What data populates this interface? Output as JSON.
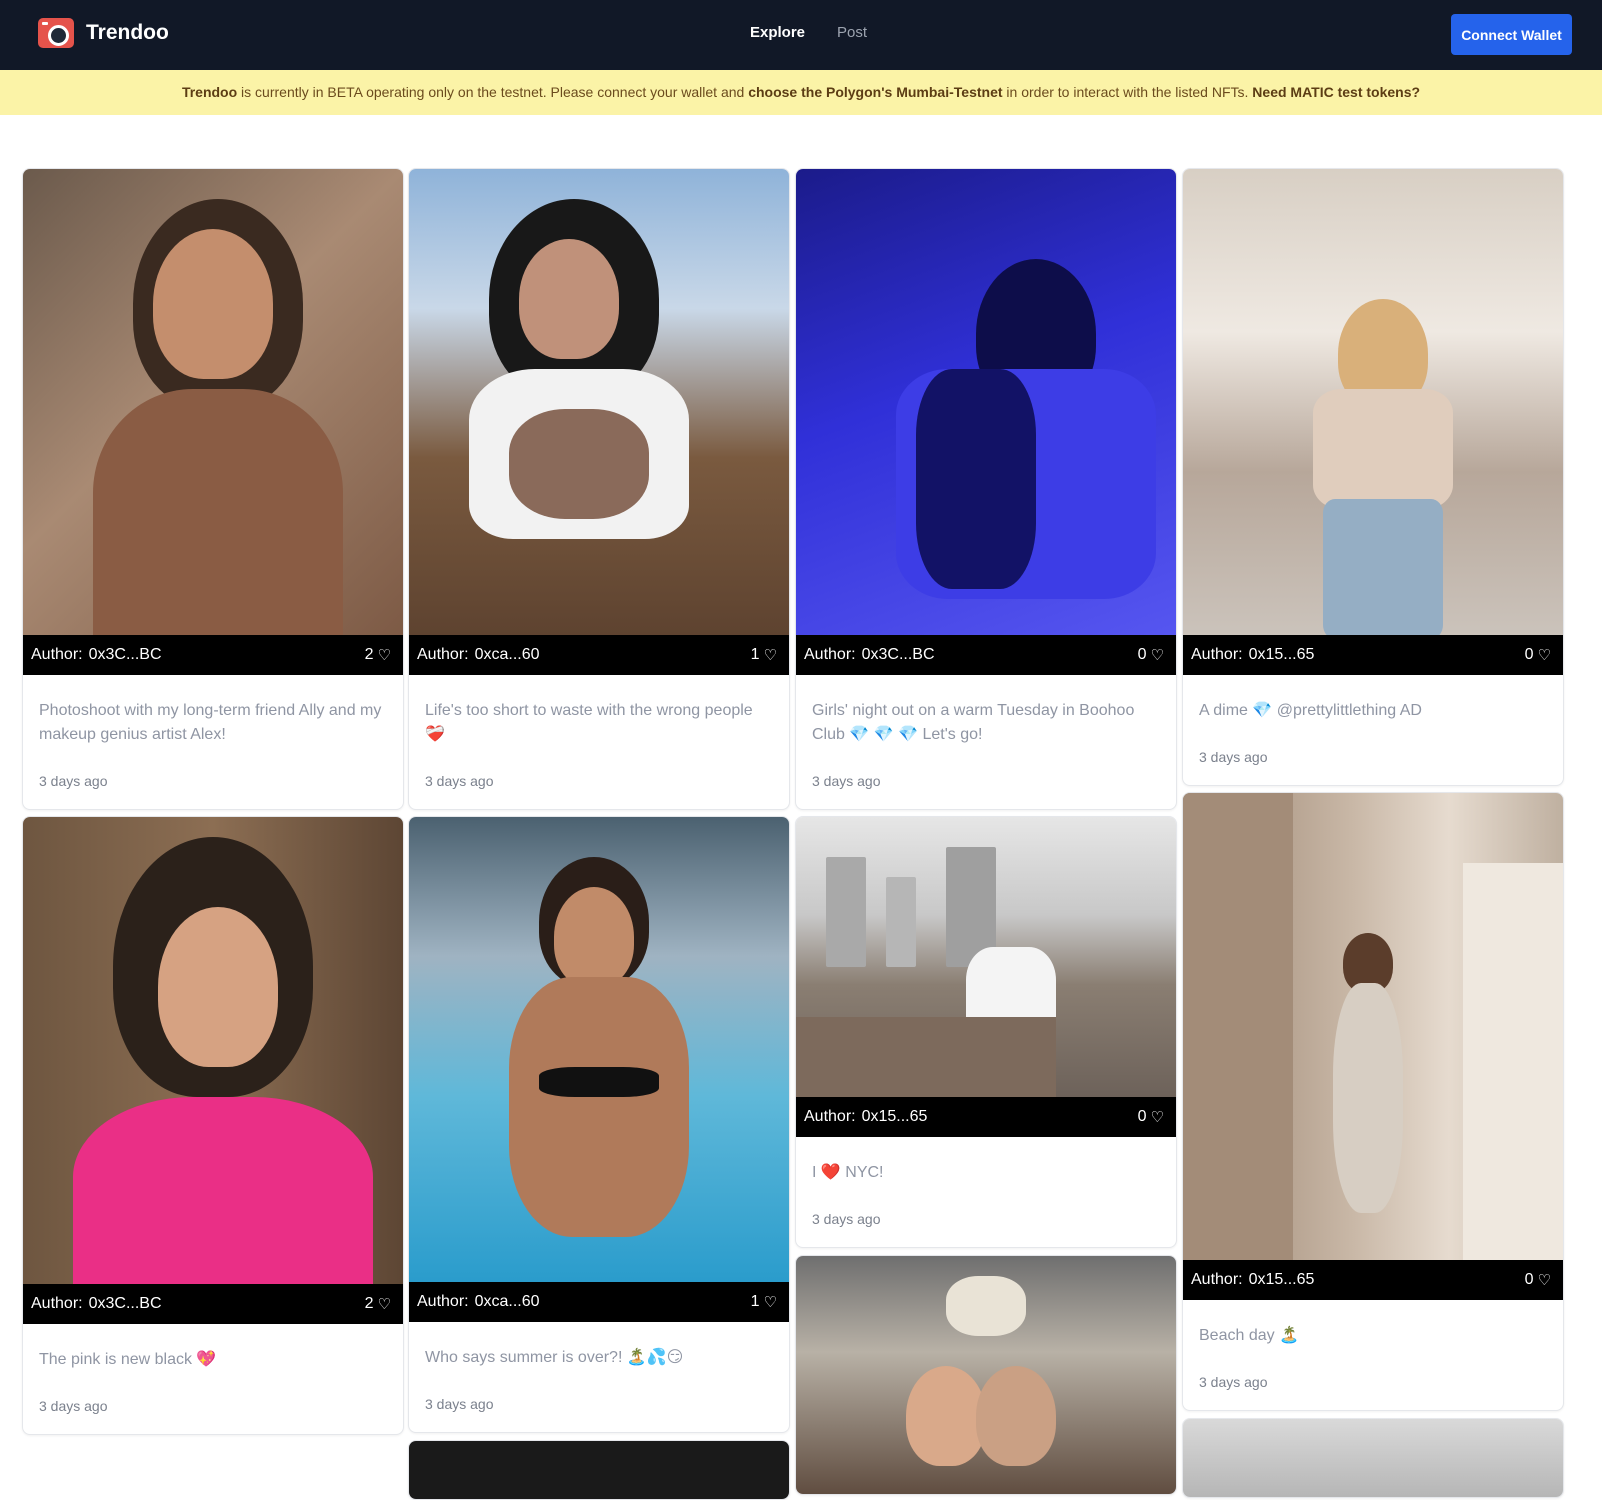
{
  "nav": {
    "brand": "Trendoo",
    "links": [
      "Explore",
      "Post"
    ],
    "connect": "Connect Wallet"
  },
  "banner": {
    "brand": "Trendoo",
    "text1": " is currently in BETA operating only on the testnet. Please connect your wallet and ",
    "strong2": "choose the Polygon's Mumbai-Testnet",
    "text3": " in order to interact with the listed NFTs. ",
    "link": "Need MATIC test tokens?"
  },
  "author_label": "Author:",
  "posts": [
    {
      "author": "0x3C...BC",
      "likes": "2",
      "desc": "Photoshoot with my long-term friend Ally and my makeup genius artist Alex!",
      "time": "3 days ago"
    },
    {
      "author": "0xca...60",
      "likes": "1",
      "desc": "Life's too short to waste with the wrong people ❤️‍🩹",
      "time": "3 days ago"
    },
    {
      "author": "0x3C...BC",
      "likes": "0",
      "desc": "Girls' night out on a warm Tuesday in Boohoo Club 💎 💎 💎 Let's go!",
      "time": "3 days ago"
    },
    {
      "author": "0x15...65",
      "likes": "0",
      "desc": "A dime 💎 @prettylittlething AD",
      "time": "3 days ago"
    },
    {
      "author": "0x3C...BC",
      "likes": "2",
      "desc": "The pink is new black 💖",
      "time": "3 days ago"
    },
    {
      "author": "0xca...60",
      "likes": "1",
      "desc": "Who says summer is over?! 🏝️💦😏",
      "time": "3 days ago"
    },
    {
      "author": "0x15...65",
      "likes": "0",
      "desc": "I ❤️ NYC!",
      "time": "3 days ago"
    },
    {
      "author": "0x15...65",
      "likes": "0",
      "desc": "Beach day 🏝️",
      "time": "3 days ago"
    }
  ],
  "colors": {
    "nav_bg": "#111827",
    "banner_bg": "#fbf3a7",
    "connect_btn": "#2563eb"
  }
}
